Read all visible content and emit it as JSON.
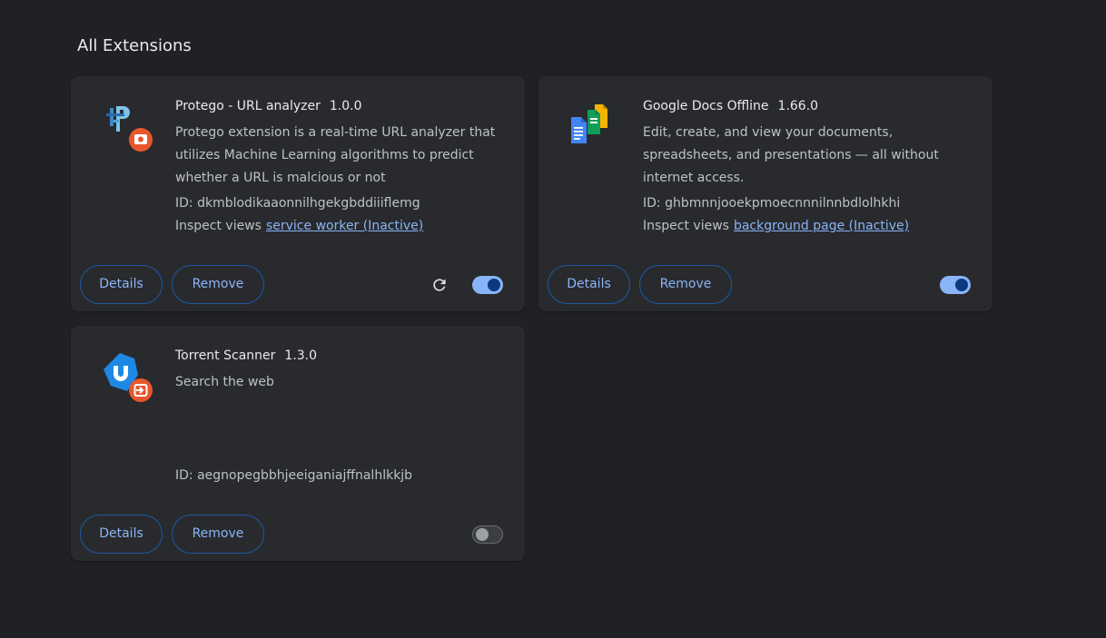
{
  "section": {
    "title": "All Extensions"
  },
  "extensions": [
    {
      "name": "Protego - URL analyzer",
      "version": "1.0.0",
      "description": "Protego extension is a real-time URL analyzer that utilizes Machine Learning algorithms to predict whether a URL is malcious or not",
      "id_text": "ID: dkmblodikaaonnilhgekgbddiiiflemg",
      "inspect_label": "Inspect views",
      "inspect_link": "service worker (Inactive)",
      "details_label": "Details",
      "remove_label": "Remove",
      "enabled": true,
      "icon": "protego-icon"
    },
    {
      "name": "Google Docs Offline",
      "version": "1.66.0",
      "description": "Edit, create, and view your documents, spreadsheets, and presentations — all without internet access.",
      "id_text": "ID: ghbmnnjooekpmoecnnnilnnbdlolhkhi",
      "inspect_label": "Inspect views",
      "inspect_link": "background page (Inactive)",
      "details_label": "Details",
      "remove_label": "Remove",
      "enabled": true,
      "icon": "google-docs-icon"
    },
    {
      "name": "Torrent Scanner",
      "version": "1.3.0",
      "description": "Search the web",
      "id_text": "ID: aegnopegbbhjeeiganiajffnalhlkkjb",
      "details_label": "Details",
      "remove_label": "Remove",
      "enabled": false,
      "icon": "torrent-scanner-icon"
    }
  ],
  "colors": {
    "background": "#202124",
    "card": "#292a2d",
    "accent": "#8ab4f8",
    "badge": "#e8572c"
  }
}
